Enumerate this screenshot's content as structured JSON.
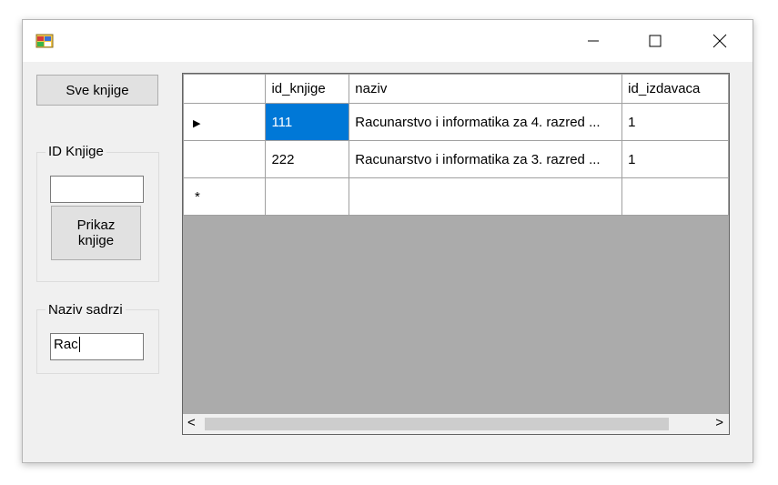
{
  "window": {
    "title": "",
    "icons": {
      "app": "app-window-icon",
      "minimize": "minimize-icon",
      "maximize": "maximize-icon",
      "close": "close-icon"
    }
  },
  "left_panel": {
    "all_books_button": "Sve knjige",
    "id_group": {
      "title": "ID Knjige",
      "input_value": "",
      "show_button": "Prikaz knjige"
    },
    "name_group": {
      "title": "Naziv sadrzi",
      "input_value": "Rac"
    }
  },
  "grid": {
    "columns": [
      "id_knjige",
      "naziv",
      "id_izdavaca"
    ],
    "rows": [
      {
        "id_knjige": "111",
        "naziv": "Racunarstvo i informatika za 4. razred ...",
        "id_izdavaca": "1"
      },
      {
        "id_knjige": "222",
        "naziv": "Racunarstvo i informatika za 3. razred ...",
        "id_izdavaca": "1"
      }
    ],
    "current_row_marker": "▶",
    "new_row_marker": "*",
    "scroll_left": "<",
    "scroll_right": ">"
  }
}
